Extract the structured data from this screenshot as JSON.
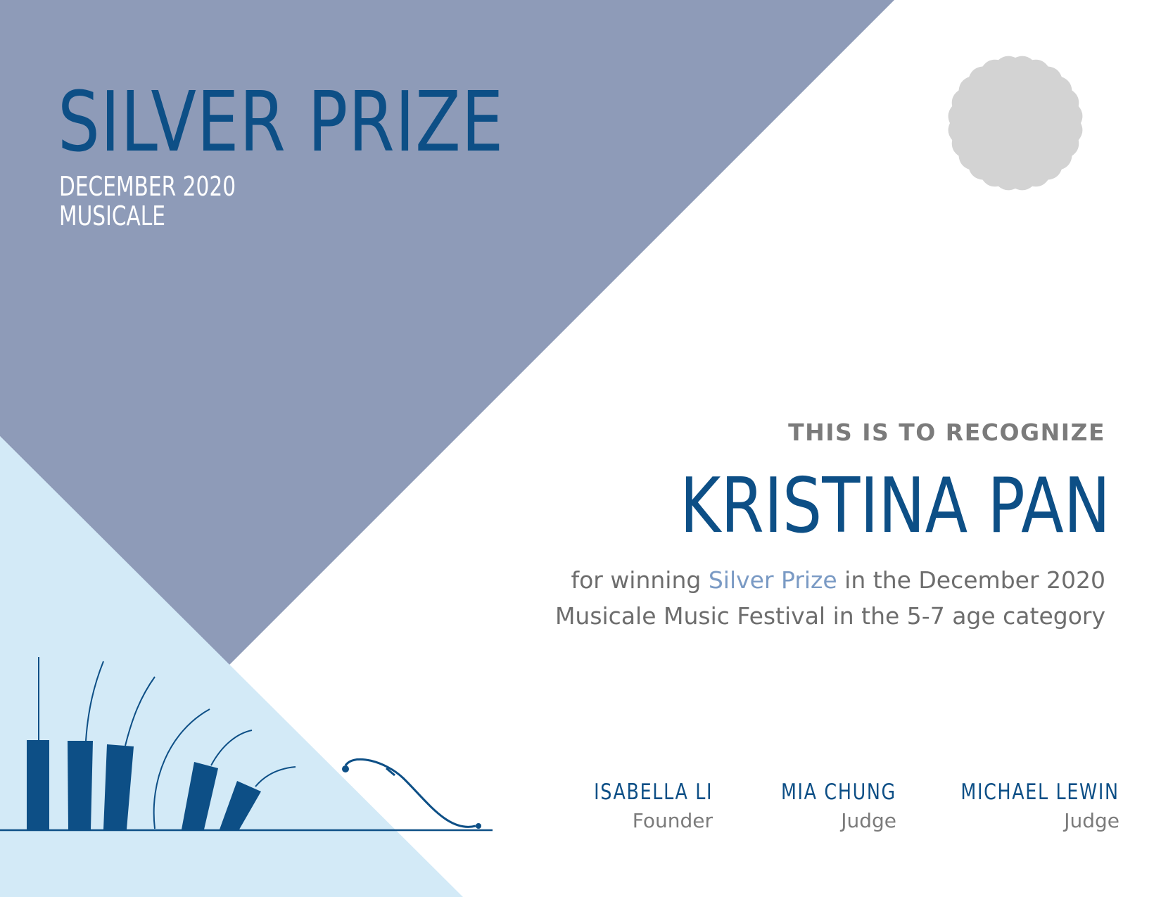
{
  "colors": {
    "slate_panel": "#8e9bb8",
    "light_blue_panel": "#d3eaf7",
    "navy_text": "#0d4f86",
    "gray_text": "#7b7b7b",
    "highlight": "#7a9ac4",
    "seal": "#d3d3d3"
  },
  "award": {
    "title": "SILVER PRIZE",
    "date": "DECEMBER 2020",
    "event": "MUSICALE"
  },
  "seal": {
    "icon": "award-seal-icon"
  },
  "recognition": {
    "intro": "THIS IS TO RECOGNIZE",
    "recipient": "KRISTINA PAN",
    "line1_before": "for winning ",
    "line1_highlight": "Silver Prize",
    "line1_after": " in the December 2020",
    "line2": "Musicale Music Festival in the 5-7 age category"
  },
  "signatories": [
    {
      "name": "ISABELLA LI",
      "role": "Founder"
    },
    {
      "name": "MIA CHUNG",
      "role": "Judge"
    },
    {
      "name": "MICHAEL LEWIN",
      "role": "Judge"
    }
  ],
  "illustration": {
    "icon": "piano-keys-icon"
  }
}
